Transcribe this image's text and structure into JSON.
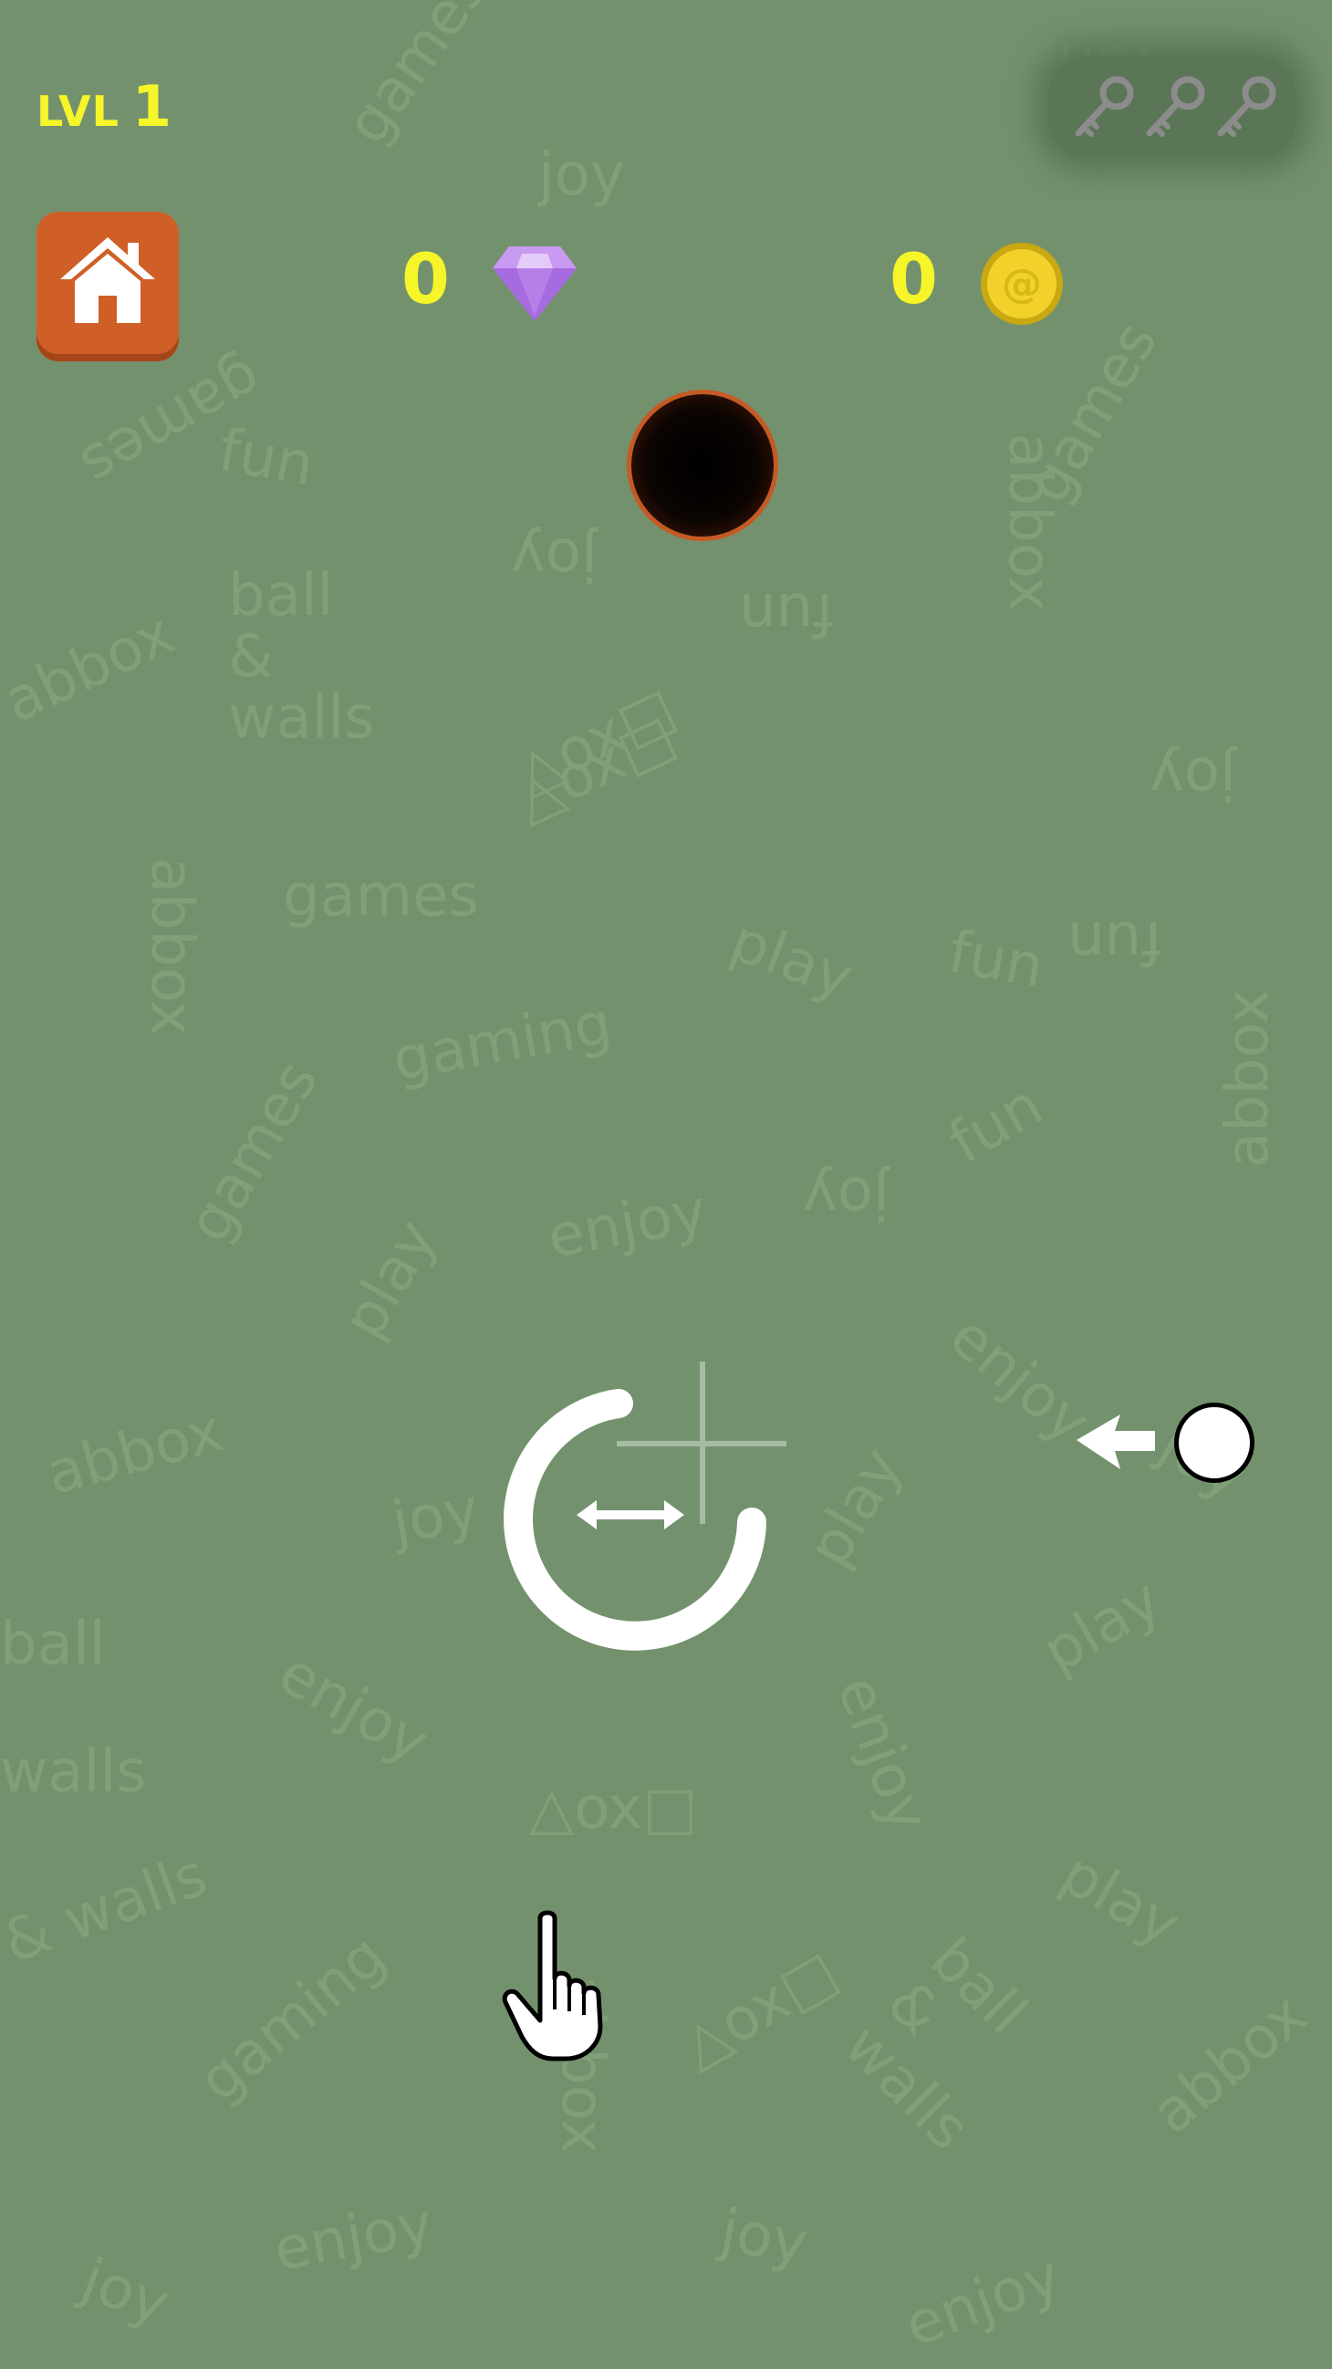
{
  "hud": {
    "level_label": "LVL",
    "level_number": "1",
    "diamond_count": "0",
    "coin_count": "0",
    "keys_total": 3,
    "keys_collected": 0
  },
  "buttons": {
    "home_icon": "house-icon"
  },
  "game": {
    "hole_icon": "black-hole",
    "ball_icon": "white-ball",
    "ball_direction_icon": "left-arrow-icon"
  },
  "tutorial": {
    "gesture_icon": "rotate-swipe-icon",
    "hand_icon": "pointing-hand-icon"
  },
  "background_words": [
    "games",
    "joy",
    "fun",
    "ball\n&\nwalls",
    "abbox",
    "△ox□",
    "games",
    "play",
    "gaming",
    "fun",
    "games",
    "enjoy",
    "play",
    "fun",
    "abbox",
    "enjoy",
    "joy",
    "abbox",
    "play",
    "ball",
    "walls",
    "enjoy",
    "△ox□",
    "enjoy",
    "play",
    "& walls",
    "gaming",
    "abbox",
    "△ox□",
    "ball\n&\nwalls",
    "abbox",
    "enjoy",
    "joy",
    "joy",
    "enjoy",
    "games",
    "fun",
    "joy",
    "△ox□",
    "abbox",
    "fun",
    "play",
    "joy",
    "fun",
    "abbox",
    "joy",
    "games",
    "joy"
  ],
  "colors": {
    "background": "#74916e",
    "hud_yellow": "#f5f52a",
    "home_button": "#cf5f27",
    "hole_rim": "#c65a24"
  }
}
